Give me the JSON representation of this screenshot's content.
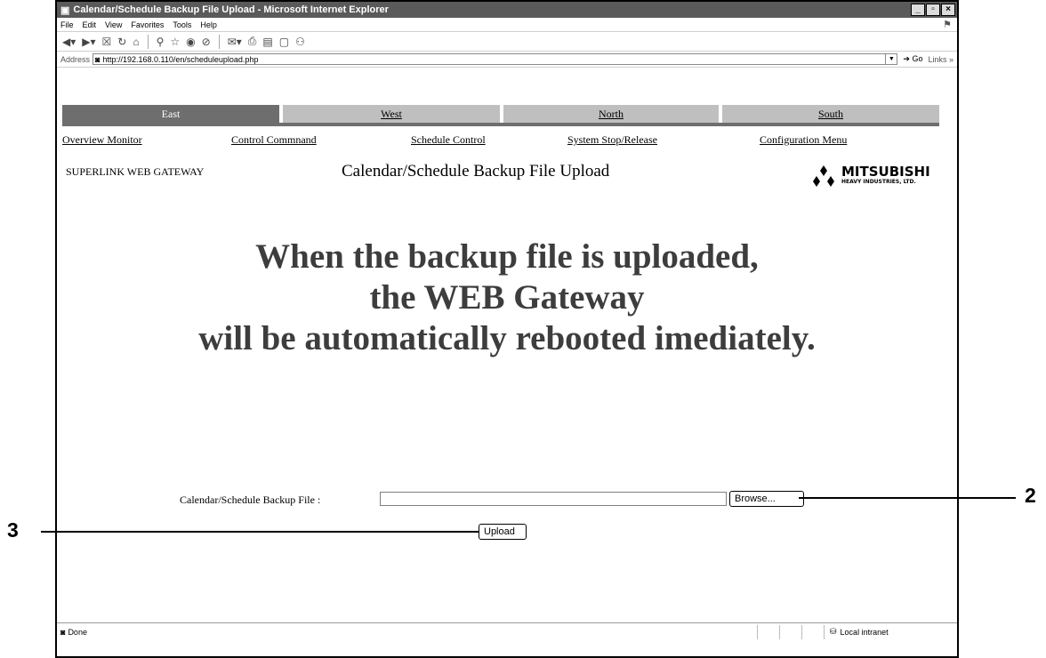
{
  "window": {
    "title": "Calendar/Schedule Backup File Upload - Microsoft Internet Explorer",
    "controls": [
      "_",
      "▫",
      "×"
    ]
  },
  "menu": [
    "File",
    "Edit",
    "View",
    "Favorites",
    "Tools",
    "Help"
  ],
  "toolbar_icons": [
    "back-icon",
    "forward-icon",
    "stop-icon",
    "refresh-icon",
    "home-icon",
    "search-icon",
    "favorites-icon",
    "media-icon",
    "history-icon",
    "mail-icon",
    "print-icon",
    "edit-icon",
    "discuss-icon",
    "messenger-icon"
  ],
  "address": {
    "label": "Address",
    "url": "http://192.168.0.110/en/scheduleupload.php",
    "go_label": "Go",
    "links_label": "Links"
  },
  "tabs": [
    "East",
    "West",
    "North",
    "South"
  ],
  "active_tab": "East",
  "submenu": [
    "Overview Monitor",
    "Control Commnand",
    "Schedule Control",
    "System Stop/Release",
    "Configuration Menu"
  ],
  "gateway_label": "SUPERLINK WEB GATEWAY",
  "page_title": "Calendar/Schedule Backup File Upload",
  "logo": {
    "name": "MITSUBISHI",
    "sub": "HEAVY INDUSTRIES, LTD."
  },
  "warning_lines": [
    "When the backup file is uploaded,",
    "the WEB Gateway",
    "will be automatically rebooted imediately."
  ],
  "upload_form": {
    "field_label": "Calendar/Schedule Backup File :",
    "file_value": "",
    "browse_label": "Browse...",
    "upload_label": "Upload"
  },
  "status": {
    "text": "Done",
    "zone": "Local intranet"
  },
  "callouts": {
    "browse": "2",
    "upload": "3"
  }
}
